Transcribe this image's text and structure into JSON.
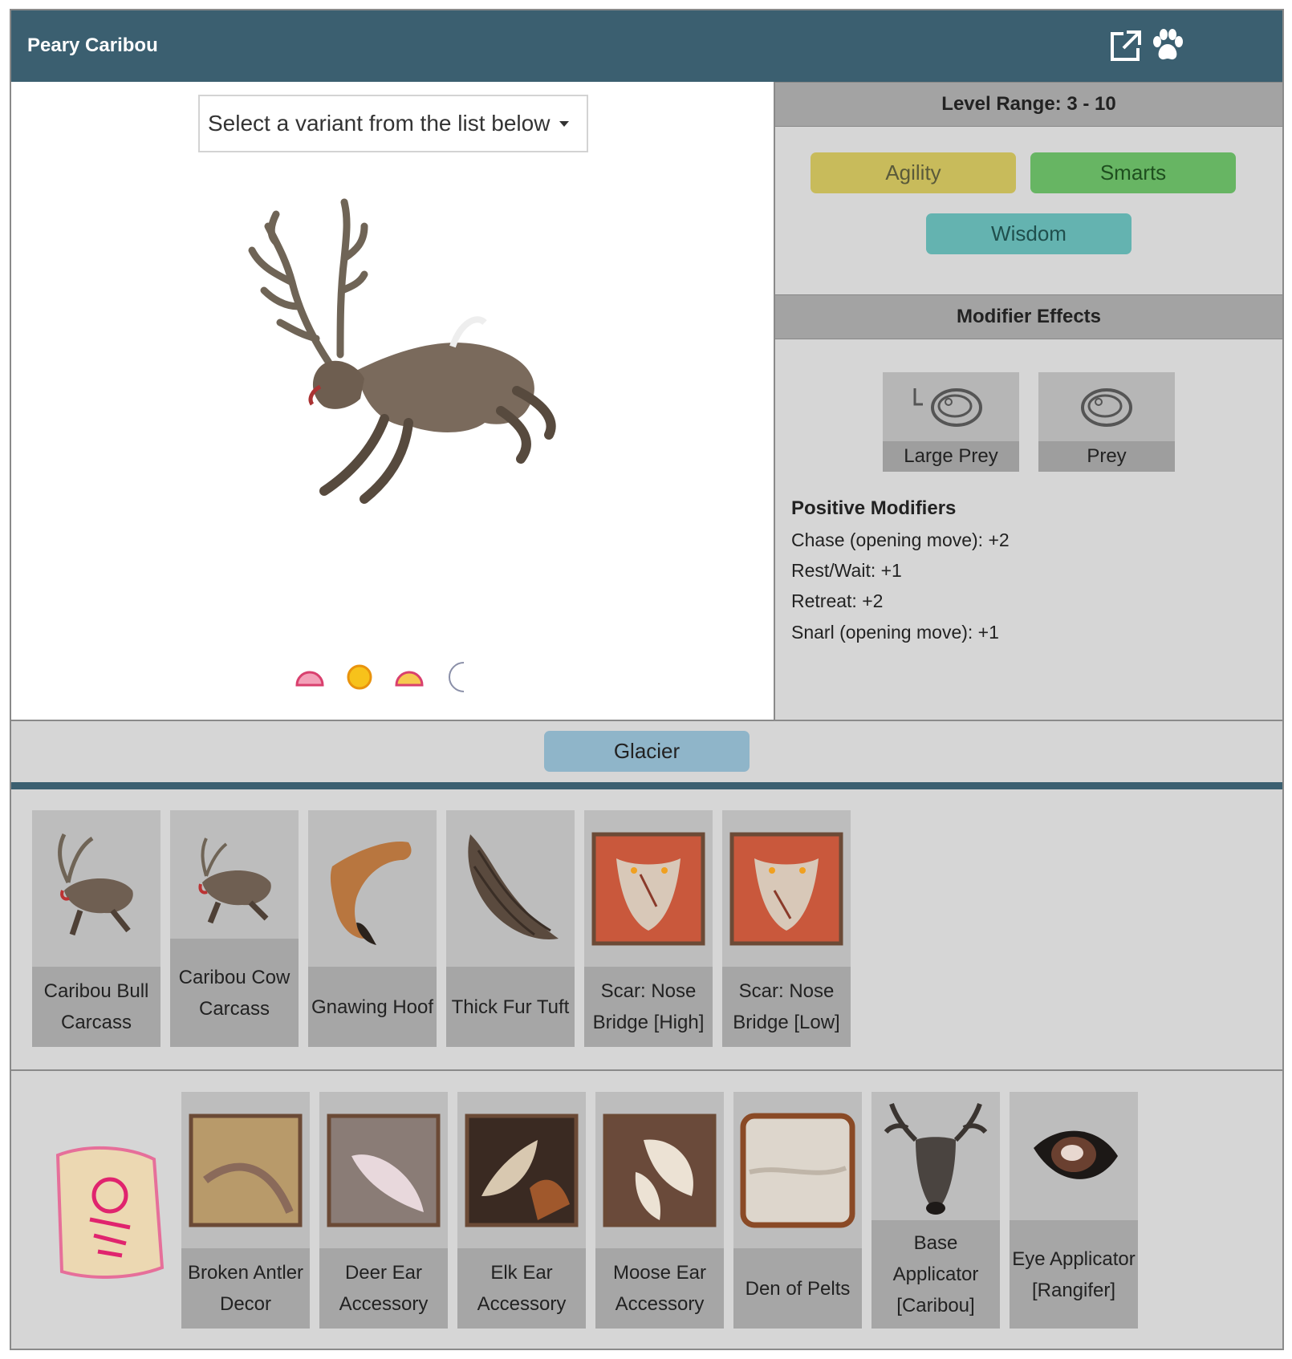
{
  "header": {
    "title": "Peary Caribou",
    "icons": [
      "external-link-icon",
      "paw-icon"
    ]
  },
  "variant_dropdown": {
    "label": "Select a variant from the list below"
  },
  "time_icons": [
    "dawn-icon",
    "day-icon",
    "dusk-icon",
    "night-icon"
  ],
  "level": {
    "label": "Level Range: 3 - 10"
  },
  "stats": [
    {
      "label": "Agility",
      "color": "#c8bb5b"
    },
    {
      "label": "Smarts",
      "color": "#67b563"
    },
    {
      "label": "Wisdom",
      "color": "#64b3b0"
    }
  ],
  "modifier_effects": {
    "title": "Modifier Effects",
    "types": [
      {
        "label": "Large Prey",
        "icon": "large-prey-icon"
      },
      {
        "label": "Prey",
        "icon": "prey-icon"
      }
    ],
    "positive_title": "Positive Modifiers",
    "positive": [
      "Chase (opening move): +2",
      "Rest/Wait: +1",
      "Retreat: +2",
      "Snarl (opening move): +1"
    ]
  },
  "habitat": {
    "label": "Glacier",
    "color": "#8fb5c9"
  },
  "drops": [
    {
      "label": "Caribou Bull Carcass",
      "icon": "caribou-bull-carcass-icon"
    },
    {
      "label": "Caribou Cow Carcass",
      "icon": "caribou-cow-carcass-icon"
    },
    {
      "label": "Gnawing Hoof",
      "icon": "gnawing-hoof-icon"
    },
    {
      "label": "Thick Fur Tuft",
      "icon": "fur-tuft-icon"
    },
    {
      "label": "Scar: Nose Bridge [High]",
      "icon": "scar-high-icon"
    },
    {
      "label": "Scar: Nose Bridge [Low]",
      "icon": "scar-low-icon"
    }
  ],
  "rewards": [
    {
      "label": "Broken Antler Decor",
      "icon": "broken-antler-icon"
    },
    {
      "label": "Deer Ear Accessory",
      "icon": "deer-ear-icon"
    },
    {
      "label": "Elk Ear Accessory",
      "icon": "elk-ear-icon"
    },
    {
      "label": "Moose Ear Accessory",
      "icon": "moose-ear-icon"
    },
    {
      "label": "Den of Pelts",
      "icon": "den-of-pelts-icon"
    },
    {
      "label": "Base Applicator [Caribou]",
      "icon": "base-applicator-icon"
    },
    {
      "label": "Eye Applicator [Rangifer]",
      "icon": "eye-applicator-icon"
    }
  ]
}
